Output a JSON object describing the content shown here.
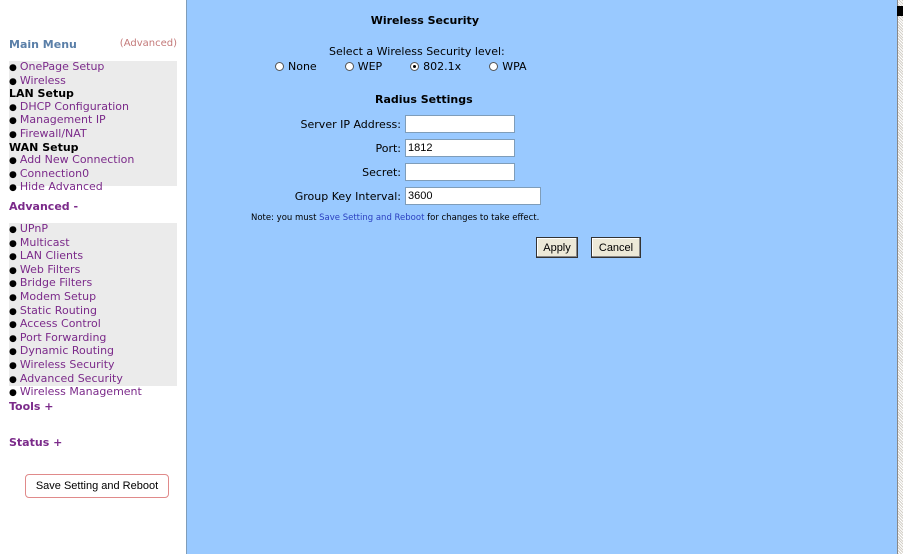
{
  "sidebar": {
    "main_menu": "Main Menu",
    "advanced_link": "(Advanced)",
    "main_items": [
      {
        "label": "OnePage Setup",
        "type": "item"
      },
      {
        "label": "Wireless",
        "type": "item"
      },
      {
        "label": "LAN Setup",
        "type": "section"
      },
      {
        "label": "DHCP Configuration",
        "type": "item"
      },
      {
        "label": "Management IP",
        "type": "item"
      },
      {
        "label": "Firewall/NAT",
        "type": "item"
      },
      {
        "label": "WAN Setup",
        "type": "section"
      },
      {
        "label": "Add New Connection",
        "type": "item"
      },
      {
        "label": "Connection0",
        "type": "item"
      },
      {
        "label": "Hide Advanced",
        "type": "item"
      }
    ],
    "advanced_title": "Advanced -",
    "advanced_items": [
      "UPnP",
      "Multicast",
      "LAN Clients",
      "Web Filters",
      "Bridge Filters",
      "Modem Setup",
      "Static Routing",
      "Access Control",
      "Port Forwarding",
      "Dynamic Routing",
      "Wireless Security",
      "Advanced Security",
      "Wireless Management"
    ],
    "tools_title": "Tools +",
    "status_title": "Status +",
    "save_button": "Save Setting and Reboot"
  },
  "main": {
    "title": "Wireless Security",
    "level_label": "Select a Wireless Security level:",
    "levels": [
      {
        "label": "None",
        "selected": false
      },
      {
        "label": "WEP",
        "selected": false
      },
      {
        "label": "802.1x",
        "selected": true
      },
      {
        "label": "WPA",
        "selected": false
      }
    ],
    "radius_heading": "Radius Settings",
    "fields": {
      "server_ip": {
        "label": "Server IP Address:",
        "value": ""
      },
      "port": {
        "label": "Port:",
        "value": "1812"
      },
      "secret": {
        "label": "Secret:",
        "value": ""
      },
      "group_key": {
        "label": "Group Key Interval:",
        "value": "3600"
      }
    },
    "note_prefix": "Note: you must ",
    "note_link": "Save Setting and Reboot",
    "note_suffix": " for changes to take effect.",
    "apply_button": "Apply",
    "cancel_button": "Cancel"
  },
  "colors": {
    "main_bg": "#99c9ff",
    "link_purple": "#7b2a8a",
    "menu_blue": "#5a7fa8",
    "note_link_blue": "#2a3fc0"
  }
}
